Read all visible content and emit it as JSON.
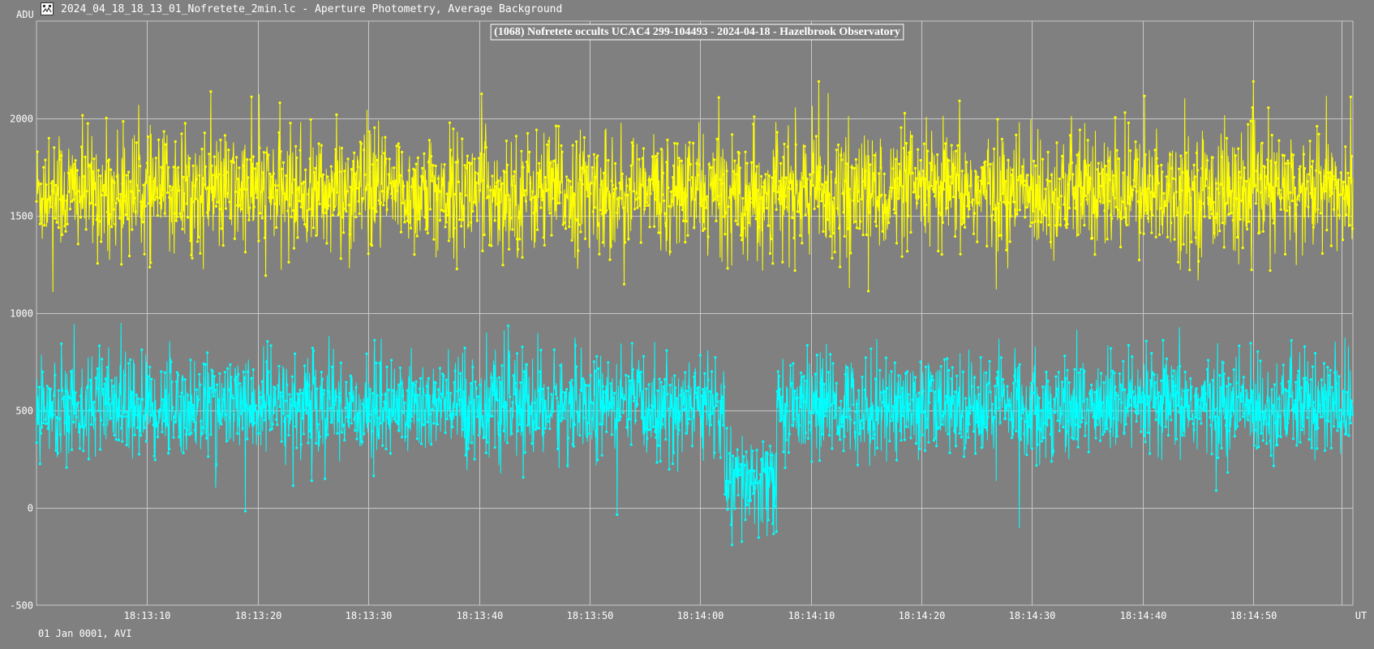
{
  "window": {
    "title": "2024_04_18_18_13_01_Nofretete_2min.lc - Aperture Photometry, Average Background",
    "icon": "lightcurve-app-icon"
  },
  "footer": {
    "text": "01 Jan 0001, AVI"
  },
  "colors": {
    "background": "#808080",
    "grid": "#c8c8c8",
    "comparison_series": "#ffff00",
    "target_series": "#00ffff",
    "text": "#ffffff"
  },
  "chart_data": {
    "type": "line",
    "title": "(1068) Nofretete occults UCAC4 299-104493 - 2024-04-18 - Hazelbrook Observatory",
    "ylabel": "ADU",
    "xlabel": "UT",
    "ylim": [
      -500,
      2500
    ],
    "y_ticks": [
      -500,
      0,
      500,
      1000,
      1500,
      2000
    ],
    "x_range": [
      "18:13:00.0",
      "18:14:59.0"
    ],
    "x_ticks": [
      "18:13:10",
      "18:13:20",
      "18:13:30",
      "18:13:40",
      "18:13:50",
      "18:14:00",
      "18:14:10",
      "18:14:20",
      "18:14:30",
      "18:14:40",
      "18:14:50"
    ],
    "grid": true,
    "markers": true,
    "frame_interval_s": 0.04,
    "series": [
      {
        "role": "comparison",
        "color": "#ffff00",
        "baseline": 1620,
        "noise_sd": 150,
        "min": 1100,
        "max": 2190
      },
      {
        "role": "target",
        "color": "#00ffff",
        "baseline": 520,
        "noise_sd": 130,
        "min": -190,
        "max": 950,
        "event": {
          "start": "18:14:02.2",
          "end": "18:14:06.9",
          "level": 120
        }
      }
    ]
  }
}
